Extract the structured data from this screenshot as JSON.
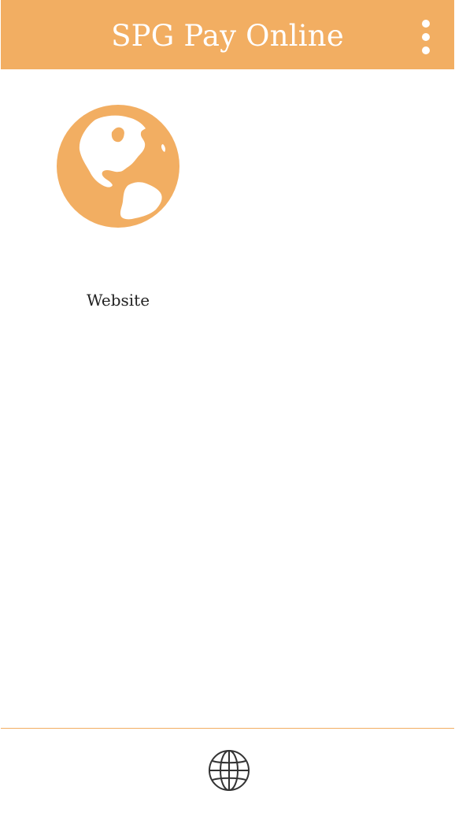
{
  "app": {
    "title": "SPG Pay Online",
    "overflow_icon": "more-vert-icon",
    "accent_color": "#f2ae62"
  },
  "tiles": [
    {
      "label": "Website",
      "icon": "globe-americas-icon"
    }
  ],
  "bottom_bar": {
    "icon": "globe-icon"
  }
}
